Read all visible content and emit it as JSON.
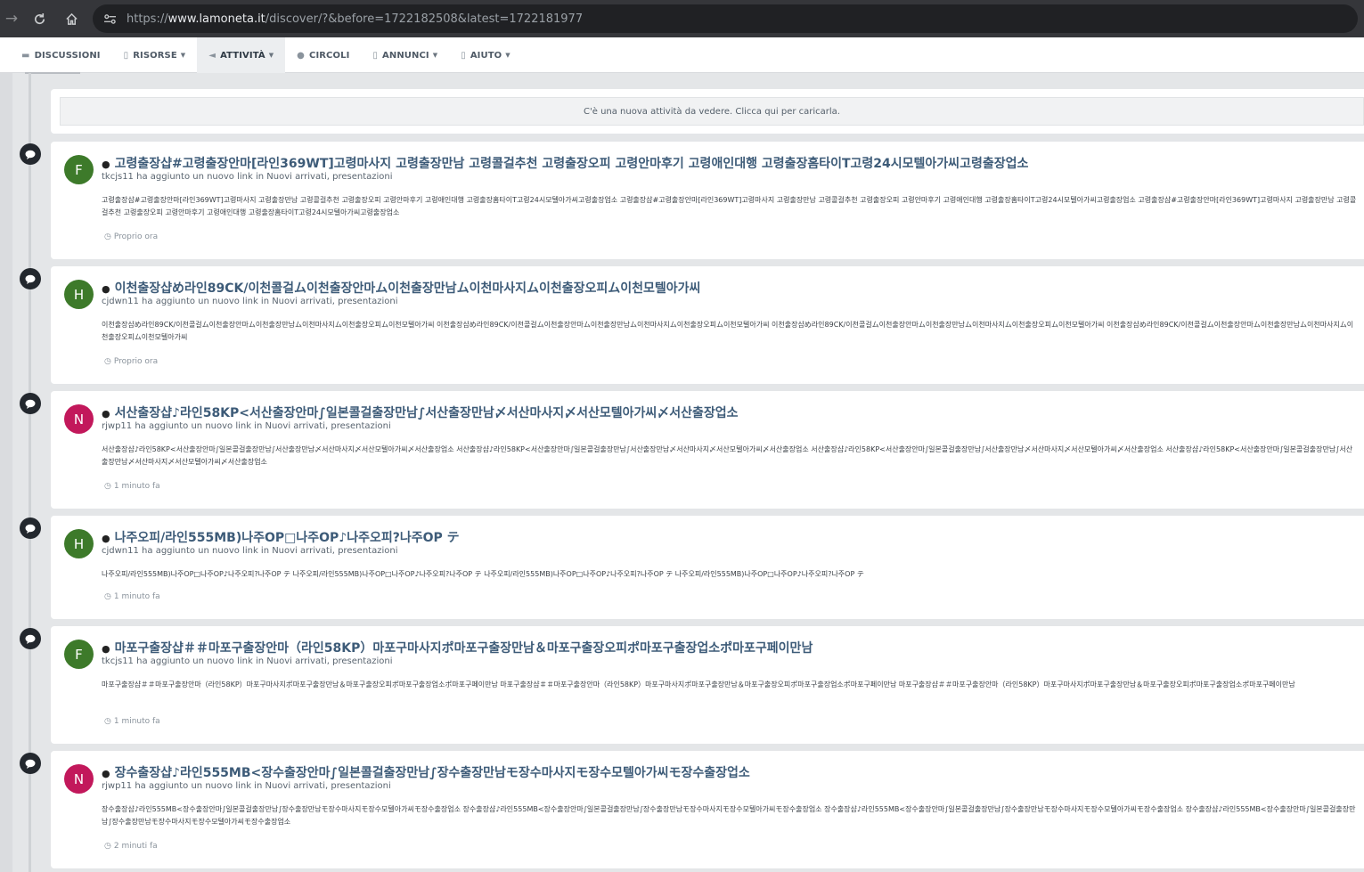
{
  "browser": {
    "url_prefix": "https://",
    "url_host": "www.lamoneta.it",
    "url_path": "/discover/?&before=1722182508&latest=1722181977"
  },
  "nav": {
    "items": [
      {
        "label": "DISCUSSIONI",
        "icon": "comments-icon",
        "active": false,
        "caret": false
      },
      {
        "label": "RISORSE",
        "icon": "document-icon",
        "active": false,
        "caret": true
      },
      {
        "label": "ATTIVITÀ",
        "icon": "megaphone-icon",
        "active": true,
        "caret": true
      },
      {
        "label": "CIRCOLI",
        "icon": "users-icon",
        "active": false,
        "caret": false
      },
      {
        "label": "ANNUNCI",
        "icon": "document-icon",
        "active": false,
        "caret": true
      },
      {
        "label": "AIUTO",
        "icon": "document-icon",
        "active": false,
        "caret": true
      }
    ]
  },
  "new_activity_notice": "C'è una nuova attività da vedere. Clicca qui per caricarla.",
  "feed": [
    {
      "avatar_letter": "F",
      "avatar_color": "#3d7a2a",
      "title": "고령출장샵#고령출장안마[라인369WT]고령마사지 고령출장만남 고령콜걸추천 고령출장오피 고령안마후기 고령애인대행 고령출장홈타이T고령24시모텔아가씨고령출장업소",
      "meta": "tkcjs11 ha aggiunto un nuovo link in Nuovi arrivati, presentazioni",
      "body": "고령출장샵#고령출장안마[라인369WT]고령마사지 고령출장만남 고령콜걸추천 고령출장오피 고령안마후기 고령애인대행 고령출장홈타이T고령24시모텔아가씨고령출장업소 고령출장샵#고령출장안마[라인369WT]고령마사지 고령출장만남 고령콜걸추천 고령출장오피 고령안마후기 고령애인대행 고령출장홈타이T고령24시모텔아가씨고령출장업소 고령출장샵#고령출장안마[라인369WT]고령마사지 고령출장만남 고령콜걸추천 고령출장오피 고령안마후기 고령애인대행 고령출장홈타이T고령24시모텔아가씨고령출장업소",
      "time": "Proprio ora"
    },
    {
      "avatar_letter": "H",
      "avatar_color": "#3d7a2a",
      "title": "이천출장샵め라인89CK/이천콜걸ム이천출장안마ム이천출장만남ム이천마사지ム이천출장오피ム이천모텔아가씨",
      "meta": "cjdwn11 ha aggiunto un nuovo link in Nuovi arrivati, presentazioni",
      "body": "이천출장샵め라인89CK/이천콜걸ム이천출장안마ム이천출장만남ム이천마사지ム이천출장오피ム이천모텔아가씨 이천출장샵め라인89CK/이천콜걸ム이천출장안마ム이천출장만남ム이천마사지ム이천출장오피ム이천모텔아가씨 이천출장샵め라인89CK/이천콜걸ム이천출장안마ム이천출장만남ム이천마사지ム이천출장오피ム이천모텔아가씨 이천출장샵め라인89CK/이천콜걸ム이천출장안마ム이천출장만남ム이천마사지ム이천출장오피ム이천모텔아가씨",
      "time": "Proprio ora"
    },
    {
      "avatar_letter": "N",
      "avatar_color": "#c2185b",
      "title": "서산출장샵♪라인58KP<서산출장안마∫일본콜걸출장만남∫서산출장만남〆서산마사지〆서산모텔아가씨〆서산출장업소",
      "meta": "rjwp11 ha aggiunto un nuovo link in Nuovi arrivati, presentazioni",
      "body": "서산출장샵♪라인58KP<서산출장안마∫일본콜걸출장만남∫서산출장만남〆서산마사지〆서산모텔아가씨〆서산출장업소 서산출장샵♪라인58KP<서산출장안마∫일본콜걸출장만남∫서산출장만남〆서산마사지〆서산모텔아가씨〆서산출장업소 서산출장샵♪라인58KP<서산출장안마∫일본콜걸출장만남∫서산출장만남〆서산마사지〆서산모텔아가씨〆서산출장업소 서산출장샵♪라인58KP<서산출장안마∫일본콜걸출장만남∫서산출장만남〆서산마사지〆서산모텔아가씨〆서산출장업소",
      "time": "1 minuto fa"
    },
    {
      "avatar_letter": "H",
      "avatar_color": "#3d7a2a",
      "title": "나주오피/라인555MB)나주OP□나주OP♪나주오피?나주OP テ",
      "meta": "cjdwn11 ha aggiunto un nuovo link in Nuovi arrivati, presentazioni",
      "body": "나주오피/라인555MB)나주OP□나주OP♪나주오피?나주OP テ 나주오피/라인555MB)나주OP□나주OP♪나주오피?나주OP テ 나주오피/라인555MB)나주OP□나주OP♪나주오피?나주OP テ 나주오피/라인555MB)나주OP□나주OP♪나주오피?나주OP テ",
      "time": "1 minuto fa"
    },
    {
      "avatar_letter": "F",
      "avatar_color": "#3d7a2a",
      "title": "마포구출장샵＃＃마포구출장안마（라인58KP）마포구마사지ポ마포구출장만남＆마포구출장오피ポ마포구출장업소ポ마포구페이만남",
      "meta": "tkcjs11 ha aggiunto un nuovo link in Nuovi arrivati, presentazioni",
      "body": "마포구출장샵＃＃마포구출장안마（라인58KP）마포구마사지ポ마포구출장만남＆마포구출장오피ポ마포구출장업소ポ마포구페이만남 마포구출장샵＃＃마포구출장안마（라인58KP）마포구마사지ポ마포구출장만남＆마포구출장오피ポ마포구출장업소ポ마포구페이만남 마포구출장샵＃＃마포구출장안마（라인58KP）마포구마사지ポ마포구출장만남＆마포구출장오피ポ마포구출장업소ポ마포구페이만남",
      "time": "1 minuto fa"
    },
    {
      "avatar_letter": "N",
      "avatar_color": "#c2185b",
      "title": "장수출장샵♪라인555MB<장수출장안마∫일본콜걸출장만남∫장수출장만남モ장수마사지モ장수모텔아가씨モ장수출장업소",
      "meta": "rjwp11 ha aggiunto un nuovo link in Nuovi arrivati, presentazioni",
      "body": "장수출장샵♪라인555MB<장수출장안마∫일본콜걸출장만남∫장수출장만남モ장수마사지モ장수모텔아가씨モ장수출장업소 장수출장샵♪라인555MB<장수출장안마∫일본콜걸출장만남∫장수출장만남モ장수마사지モ장수모텔아가씨モ장수출장업소 장수출장샵♪라인555MB<장수출장안마∫일본콜걸출장만남∫장수출장만남モ장수마사지モ장수모텔아가씨モ장수출장업소 장수출장샵♪라인555MB<장수출장안마∫일본콜걸출장만남∫장수출장만남モ장수마사지モ장수모텔아가씨モ장수출장업소",
      "time": "2 minuti fa"
    }
  ]
}
